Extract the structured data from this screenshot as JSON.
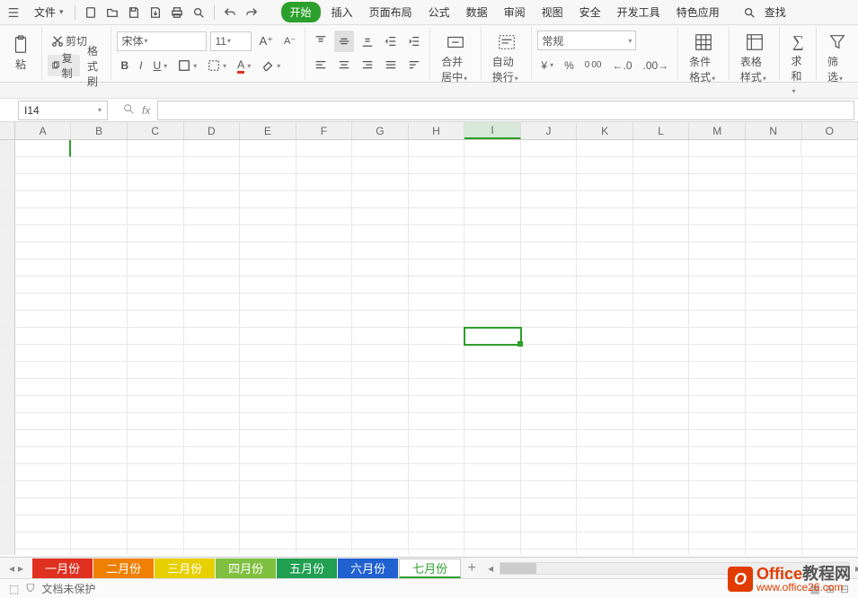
{
  "qat": {
    "file_label": "文件"
  },
  "menu": {
    "tabs": [
      "开始",
      "插入",
      "页面布局",
      "公式",
      "数据",
      "审阅",
      "视图",
      "安全",
      "开发工具",
      "特色应用"
    ],
    "search": "查找"
  },
  "ribbon": {
    "cut": "剪切",
    "copy": "复制",
    "format_painter": "格式刷",
    "paste": "粘",
    "font_name": "宋体",
    "font_size": "11",
    "merge_center": "合并居中",
    "wrap_text": "自动换行",
    "number_format": "常规",
    "cond_format": "条件格式",
    "table_style": "表格样式",
    "sum": "求和",
    "filter": "筛选"
  },
  "namebox": "I14",
  "columns": [
    "A",
    "B",
    "C",
    "D",
    "E",
    "F",
    "G",
    "H",
    "I",
    "J",
    "K",
    "L",
    "M",
    "N",
    "O"
  ],
  "selected_col": "I",
  "sheets": [
    {
      "name": "一月份",
      "color": "#e03020"
    },
    {
      "name": "二月份",
      "color": "#f08000"
    },
    {
      "name": "三月份",
      "color": "#e8d000"
    },
    {
      "name": "四月份",
      "color": "#80c040"
    },
    {
      "name": "五月份",
      "color": "#20a050"
    },
    {
      "name": "六月份",
      "color": "#2060d0"
    },
    {
      "name": "七月份",
      "color": "#ffffff",
      "active": true
    }
  ],
  "status": {
    "protect": "文档未保护"
  },
  "watermark": {
    "line1a": "Office",
    "line1b": "教程网",
    "line2": "www.office26.com"
  }
}
